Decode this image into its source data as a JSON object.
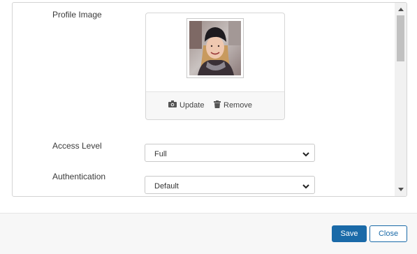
{
  "form": {
    "profile_image_label": "Profile Image",
    "update_label": "Update",
    "remove_label": "Remove",
    "access_level_label": "Access Level",
    "access_level_value": "Full",
    "authentication_label": "Authentication",
    "authentication_value": "Default"
  },
  "footer": {
    "save_label": "Save",
    "close_label": "Close"
  },
  "icons": {
    "update": "camera-icon",
    "remove": "trash-icon",
    "select_arrow": "chevron-down-icon"
  },
  "colors": {
    "primary": "#1a6aa8"
  }
}
